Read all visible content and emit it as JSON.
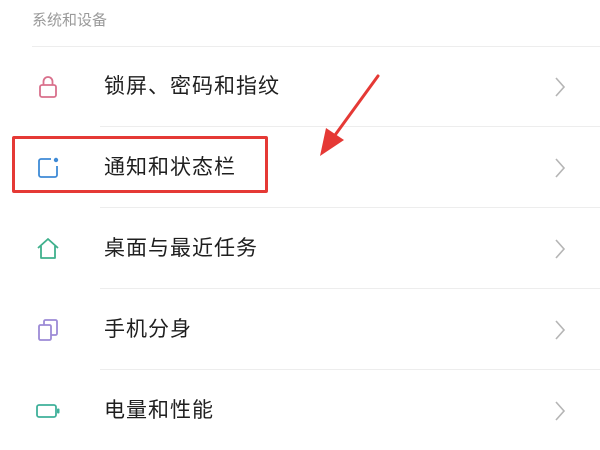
{
  "section": {
    "title": "系统和设备"
  },
  "items": [
    {
      "label": "锁屏、密码和指纹",
      "icon": "lock-icon",
      "color": "#d9708c"
    },
    {
      "label": "通知和状态栏",
      "icon": "notification-icon",
      "color": "#3e8ad6"
    },
    {
      "label": "桌面与最近任务",
      "icon": "home-icon",
      "color": "#3fb08c"
    },
    {
      "label": "手机分身",
      "icon": "clone-icon",
      "color": "#9c8ad6"
    },
    {
      "label": "电量和性能",
      "icon": "battery-icon",
      "color": "#3fb09a"
    }
  ],
  "annotation": {
    "highlight_color": "#e53935"
  }
}
